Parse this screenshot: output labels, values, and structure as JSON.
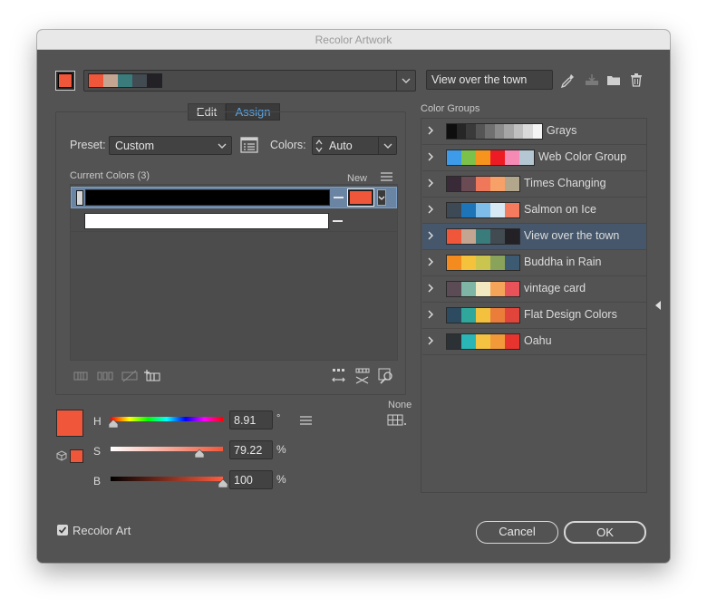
{
  "window": {
    "title": "Recolor Artwork"
  },
  "top_bar": {
    "active_color": "#f0573a",
    "group_swatches": [
      "#f0573a",
      "#c4a592",
      "#3a7c7b",
      "#424b52",
      "#232026"
    ],
    "group_name_value": "View over the town"
  },
  "tabs": {
    "edit": "Edit",
    "assign": "Assign"
  },
  "preset": {
    "label": "Preset:",
    "value": "Custom"
  },
  "colors": {
    "label": "Colors:",
    "value": "Auto"
  },
  "current_colors": {
    "header": "Current Colors (3)",
    "new_label": "New",
    "rows": [
      {
        "current": "#000000",
        "new": "#f0573a"
      },
      {
        "current": "#ffffff",
        "new": ""
      }
    ]
  },
  "none_label": "None",
  "hsb": {
    "preview": "#f0573a",
    "h": {
      "label": "H",
      "value": "8.91",
      "unit": "°",
      "fraction": 0.025
    },
    "s": {
      "label": "S",
      "value": "79.22",
      "unit": "%",
      "fraction": 0.7922
    },
    "b": {
      "label": "B",
      "value": "100",
      "unit": "%",
      "fraction": 1.0
    }
  },
  "recolor_art": {
    "label": "Recolor Art",
    "checked": true
  },
  "buttons": {
    "cancel": "Cancel",
    "ok": "OK"
  },
  "color_groups": {
    "title": "Color Groups",
    "items": [
      {
        "name": "Grays",
        "swatches": [
          "#0e0e0e",
          "#262626",
          "#3a3a3a",
          "#555555",
          "#707070",
          "#8c8c8c",
          "#a6a6a6",
          "#c0c0c0",
          "#dadada",
          "#f4f4f4"
        ],
        "selected": false
      },
      {
        "name": "Web Color Group",
        "swatches": [
          "#3d9be9",
          "#7cc24a",
          "#f7941d",
          "#ed1c24",
          "#f58ab4",
          "#b4c7d2"
        ],
        "selected": false
      },
      {
        "name": "Times Changing",
        "swatches": [
          "#382a36",
          "#6a4a53",
          "#f0785a",
          "#f7a067",
          "#b2a68d"
        ],
        "selected": false
      },
      {
        "name": "Salmon on Ice",
        "swatches": [
          "#3d4a56",
          "#1d75b8",
          "#7dbde8",
          "#d6e9f5",
          "#f57b5f"
        ],
        "selected": false
      },
      {
        "name": "View over the town",
        "swatches": [
          "#f0573a",
          "#c4a592",
          "#3a7c7b",
          "#424b52",
          "#232026"
        ],
        "selected": true
      },
      {
        "name": "Buddha in Rain",
        "swatches": [
          "#f38b1e",
          "#f5c23c",
          "#c9c54f",
          "#8aa35b",
          "#3d5a73"
        ],
        "selected": false
      },
      {
        "name": "vintage card",
        "swatches": [
          "#5b4b55",
          "#7fb5a4",
          "#f2e9c0",
          "#f5a55a",
          "#e8535a"
        ],
        "selected": false
      },
      {
        "name": "Flat Design Colors",
        "swatches": [
          "#2c4a60",
          "#2fa89b",
          "#f3c13e",
          "#ea7d3a",
          "#e0443a"
        ],
        "selected": false
      },
      {
        "name": "Oahu",
        "swatches": [
          "#2c3136",
          "#2ab6b7",
          "#f5c341",
          "#f29a3a",
          "#e8342f"
        ],
        "selected": false
      }
    ]
  }
}
